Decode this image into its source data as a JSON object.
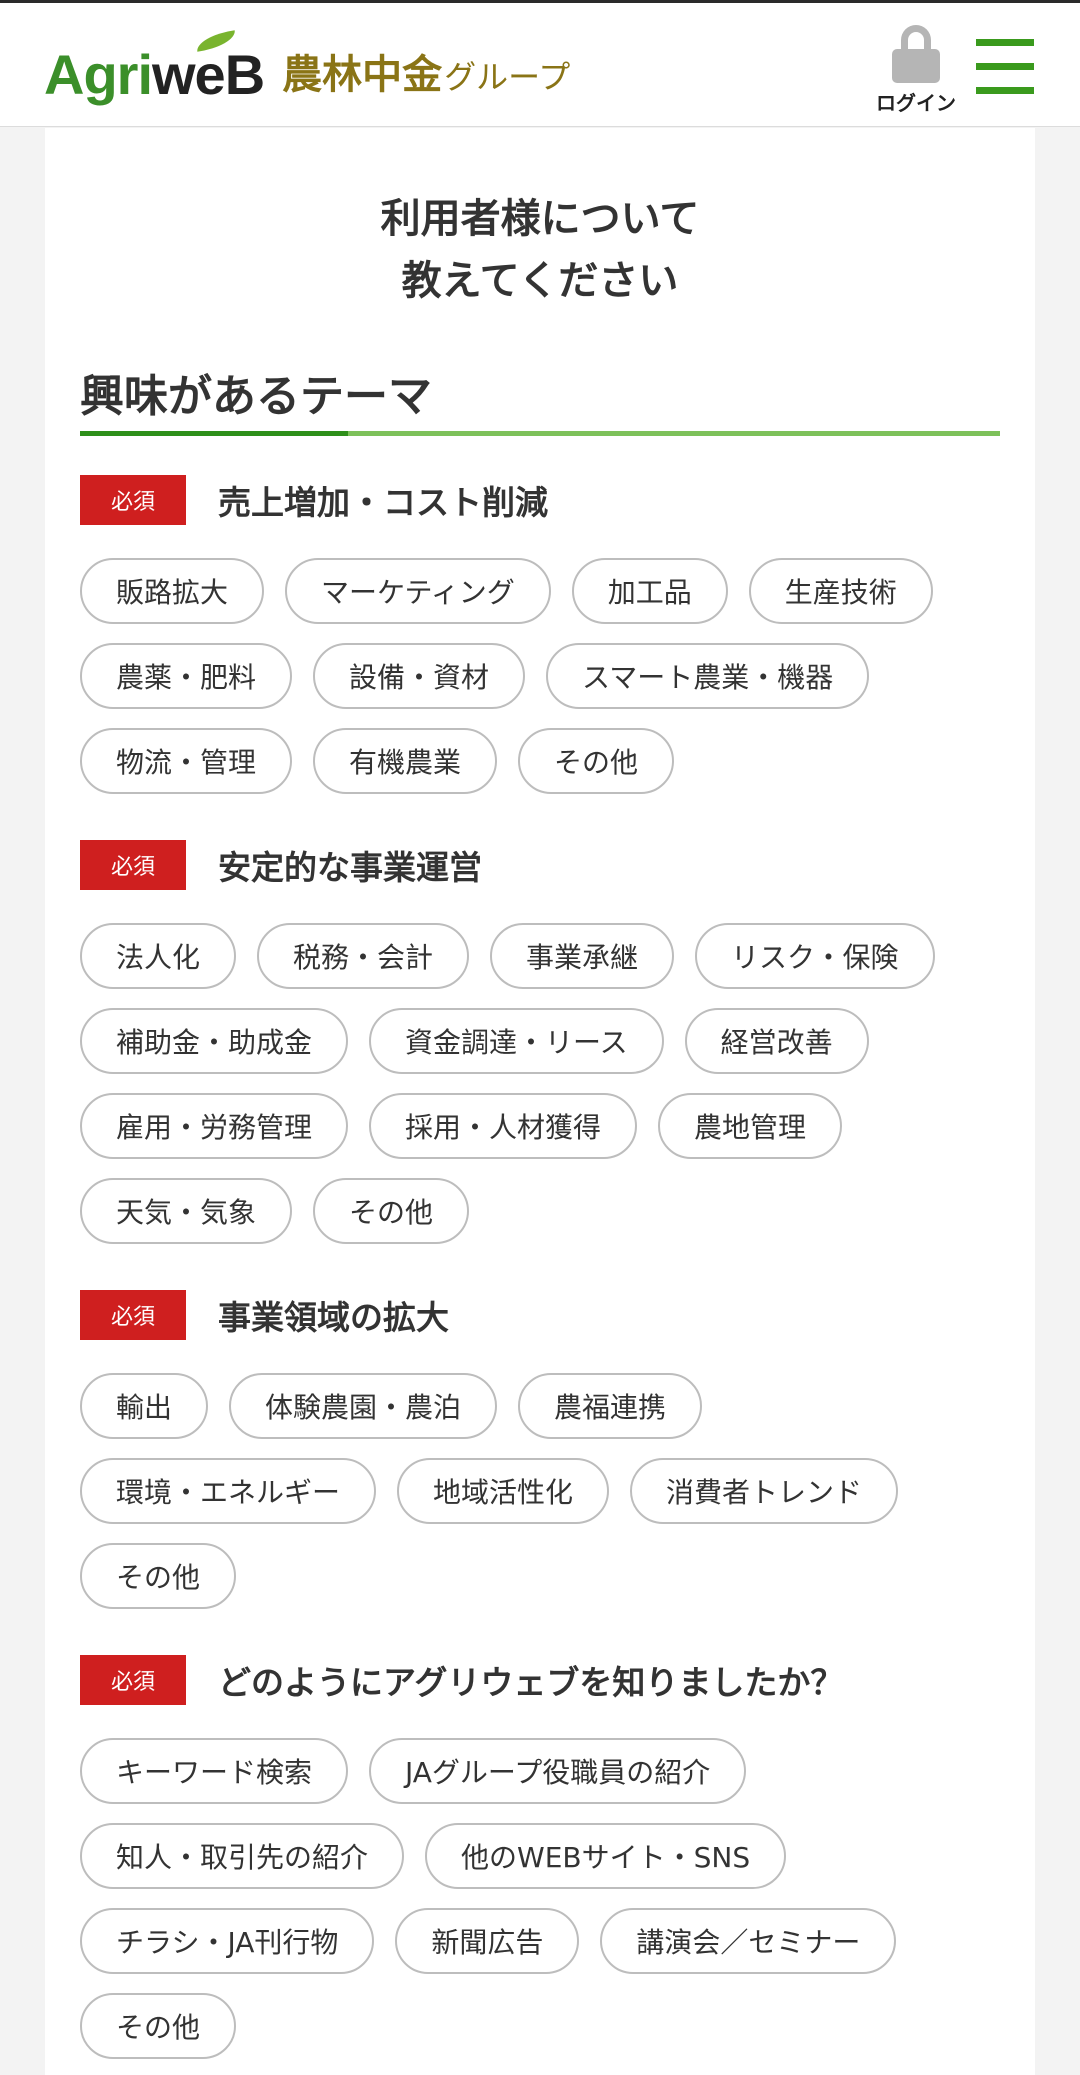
{
  "header": {
    "logo_agri": "Agri",
    "logo_web": "weB",
    "logo_group_main": "農林中金",
    "logo_group_suffix": "グループ",
    "login_label": "ログイン"
  },
  "intro": {
    "line1": "利用者様について",
    "line2": "教えてください"
  },
  "section_title": "興味があるテーマ",
  "questions": [
    {
      "required_badge": "必須",
      "title": "売上増加・コスト削減",
      "options": [
        "販路拡大",
        "マーケティング",
        "加工品",
        "生産技術",
        "農薬・肥料",
        "設備・資材",
        "スマート農業・機器",
        "物流・管理",
        "有機農業",
        "その他"
      ]
    },
    {
      "required_badge": "必須",
      "title": "安定的な事業運営",
      "options": [
        "法人化",
        "税務・会計",
        "事業承継",
        "リスク・保険",
        "補助金・助成金",
        "資金調達・リース",
        "経営改善",
        "雇用・労務管理",
        "採用・人材獲得",
        "農地管理",
        "天気・気象",
        "その他"
      ]
    },
    {
      "required_badge": "必須",
      "title": "事業領域の拡大",
      "options": [
        "輸出",
        "体験農園・農泊",
        "農福連携",
        "環境・エネルギー",
        "地域活性化",
        "消費者トレンド",
        "その他"
      ]
    },
    {
      "required_badge": "必須",
      "title": "どのようにアグリウェブを知りましたか？",
      "options": [
        "キーワード検索",
        "JAグループ役職員の紹介",
        "知人・取引先の紹介",
        "他のWEBサイト・SNS",
        "チラシ・JA刊行物",
        "新聞広告",
        "講演会／セミナー",
        "その他"
      ]
    }
  ],
  "colors": {
    "brand_green": "#3a9a1d",
    "required_red": "#cf1f1f",
    "group_gold": "#8a7416"
  }
}
